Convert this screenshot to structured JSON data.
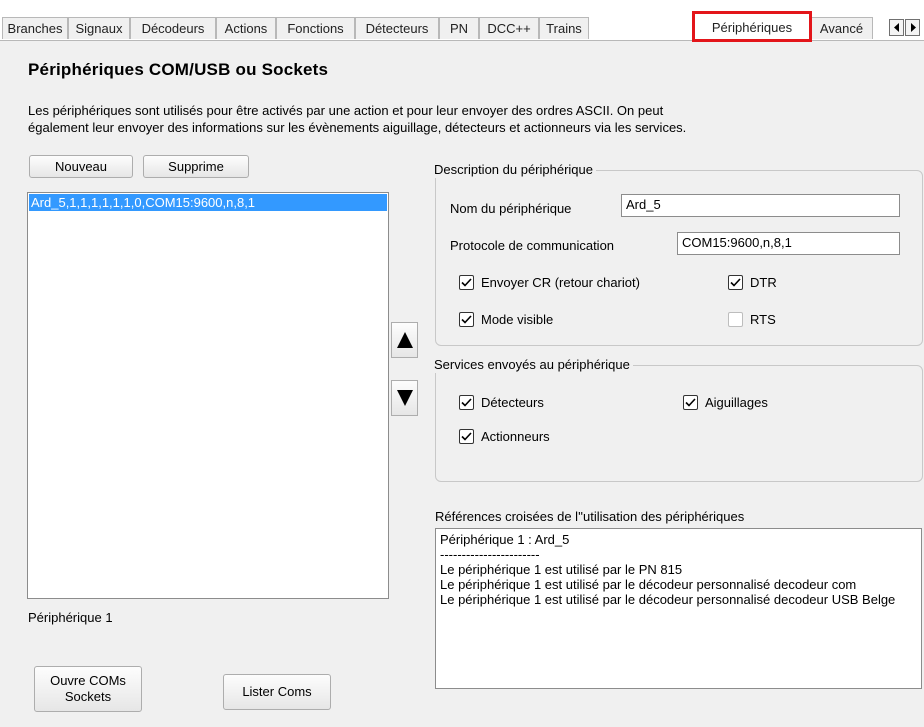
{
  "tabs": [
    "Branches",
    "Signaux",
    "Décodeurs",
    "Actions",
    "Fonctions",
    "Détecteurs",
    "PN",
    "DCC++",
    "Trains",
    "Périphériques",
    "Avancé"
  ],
  "active_tab": "Périphériques",
  "page": {
    "title": "Périphériques COM/USB ou Sockets",
    "description_line1": "Les périphériques sont utilisés pour être activés par une action et pour leur envoyer des ordres ASCII. On peut",
    "description_line2": "également leur envoyer des informations sur les évènements aiguillage, détecteurs et actionneurs via les services."
  },
  "buttons": {
    "new": "Nouveau",
    "delete": "Supprime",
    "open_coms_line1": "Ouvre COMs",
    "open_coms_line2": "Sockets",
    "list_coms": "Lister Coms"
  },
  "device_list": {
    "items": [
      "Ard_5,1,1,1,1,1,1,0,COM15:9600,n,8,1"
    ],
    "selected_index": 0
  },
  "status_label": "Périphérique 1",
  "description_group": {
    "title": "Description du périphérique",
    "name_label": "Nom du périphérique",
    "name_value": "Ard_5",
    "protocol_label": "Protocole de communication",
    "protocol_value": "COM15:9600,n,8,1",
    "checkboxes": [
      {
        "label": "Envoyer CR (retour chariot)",
        "checked": true
      },
      {
        "label": "DTR",
        "checked": true
      },
      {
        "label": "Mode visible",
        "checked": true
      },
      {
        "label": "RTS",
        "checked": false
      }
    ]
  },
  "services_group": {
    "title": "Services envoyés au périphérique",
    "checkboxes": [
      {
        "label": "Détecteurs",
        "checked": true
      },
      {
        "label": "Aiguillages",
        "checked": true
      },
      {
        "label": "Actionneurs",
        "checked": true
      }
    ]
  },
  "cross_ref": {
    "title": "Références croisées de l''utilisation des périphériques",
    "lines": [
      "Périphérique 1 : Ard_5",
      "-----------------------",
      "Le périphérique 1 est utilisé par le PN 815",
      "Le périphérique 1 est utilisé par le décodeur personnalisé decodeur com",
      "Le périphérique 1 est utilisé par le décodeur personnalisé decodeur USB Belge"
    ]
  },
  "colors": {
    "selection": "#3399ff",
    "highlight_border": "#e3151a",
    "panel_bg": "#f0f0f0"
  }
}
